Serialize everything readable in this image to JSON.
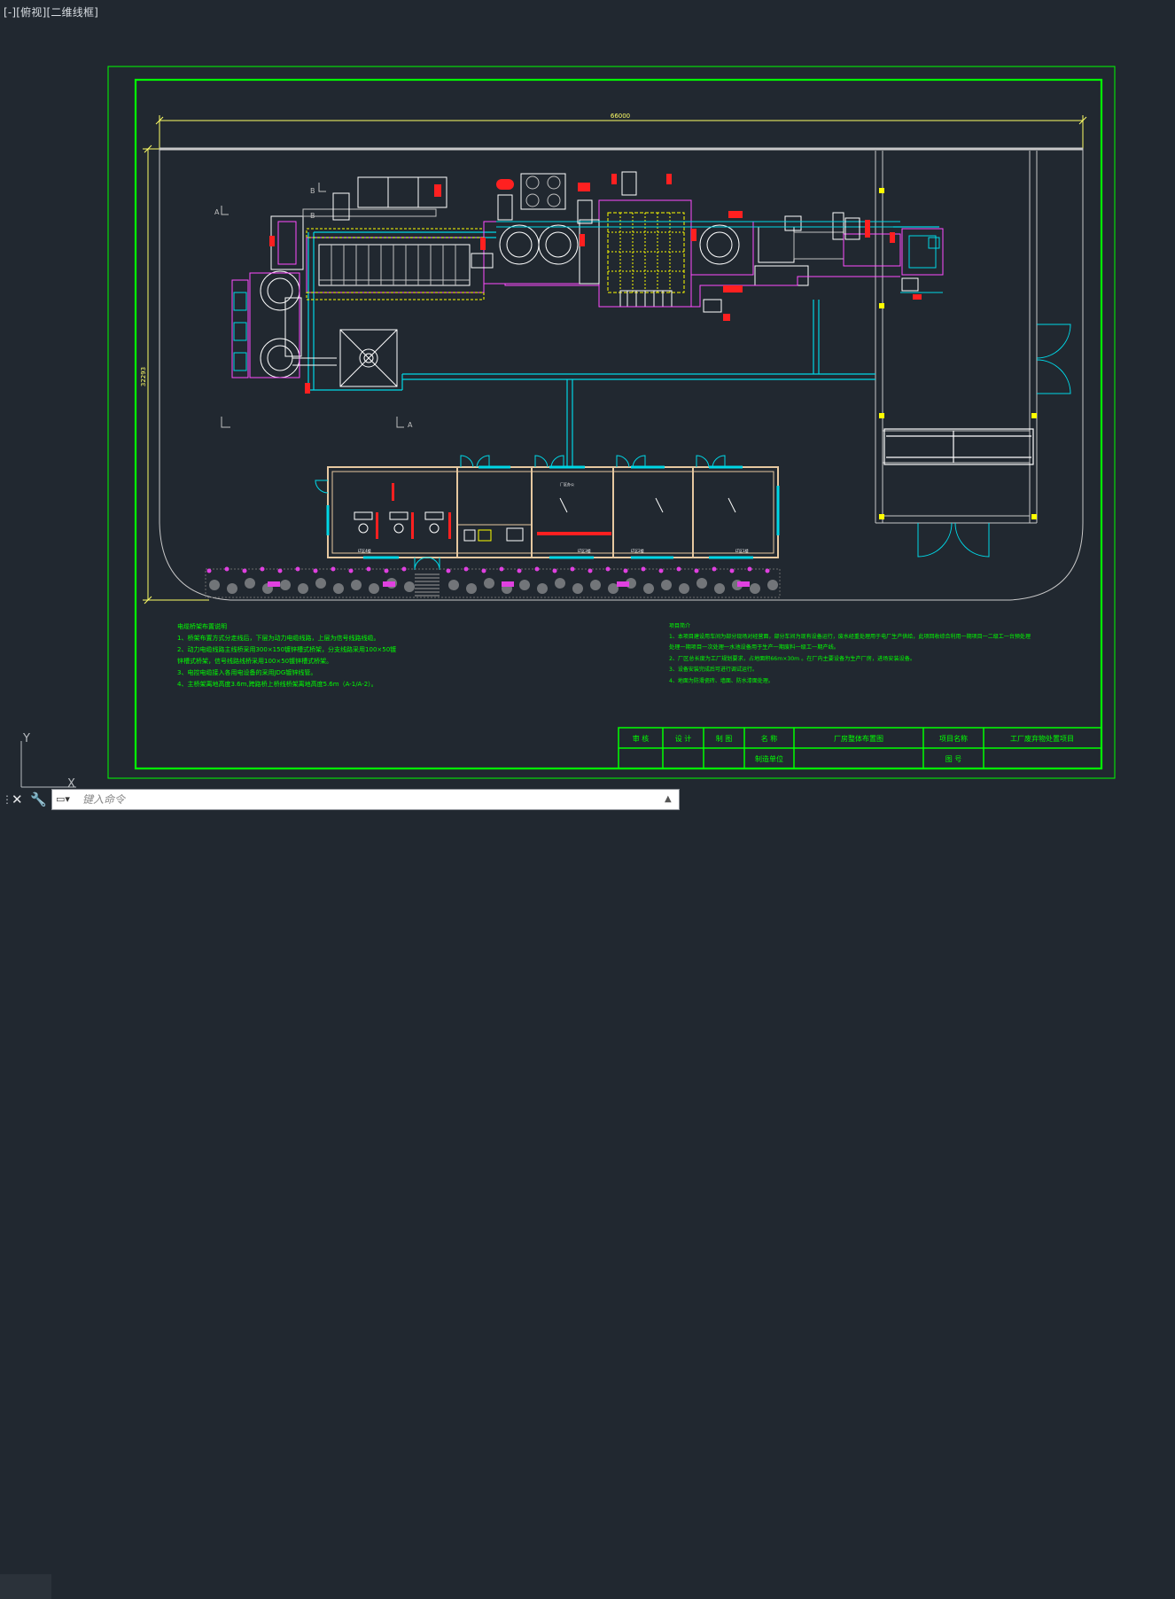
{
  "viewport": {
    "label": "[-][俯视][二维线框]"
  },
  "dimensions": {
    "horizontal": "66000",
    "vertical": "32293"
  },
  "section_marks": [
    "A",
    "A",
    "B",
    "B"
  ],
  "notes_left": {
    "title": "电缆桥架布置说明",
    "lines": [
      "1、桥架布置方式分走线后，下层为动力电缆线路，上层为信号线路线缆。",
      "2、动力电缆线路主线桥采用300×150镀锌槽式桥架，分支线路采用100×50镀",
      "    锌槽式桥架，信号线路线桥采用100×50镀锌槽式桥架。",
      "3、电控电缆接入各用电设备的采用JDG镀锌线管。",
      "4、主桥架离地高度3.6m,跨路桥上桥线桥架离地高度5.6m（A-1/A-2）。"
    ]
  },
  "notes_right": {
    "title": "项目简介",
    "lines": [
      "1、本项目建设用车间为部分现场对经营面，部分车间为现有设备运行，废水经重处理用于电厂生产供给，此项回收综合利用一期项目一二级工一台预处理",
      "处理一期项目一次处理一水池设备用于生产一期废料一级工一期产线。",
      "2、厂区总长度为工厂规划要求，占地面积66m×30m         。在厂内主要设备为生产厂房，进场安装设备。",
      "3、设备安装完成后可进行调试运行。",
      "4、地面为防滑瓷砖、墙面、防水漆面处理。"
    ]
  },
  "title_block": {
    "row1": [
      "审 核",
      "设 计",
      "制 图",
      "名 称",
      "厂房整体布置图",
      "项目名称",
      "工厂废弃物处置项目"
    ],
    "row2": [
      "制造单位",
      "图 号"
    ]
  },
  "room_labels": [
    "厂区办公",
    "LT区4楼",
    "LT区3楼",
    "LT区2楼",
    "LT区1楼"
  ],
  "command_line": {
    "placeholder": "键入命令"
  },
  "ucs": {
    "y_label": "Y",
    "x_label": "X"
  },
  "colors": {
    "background": "#212830",
    "frame_green": "#00ff00",
    "cyan": "#00d7e6",
    "magenta": "#ff4cff",
    "yellow": "#ffff00",
    "red": "#ff2020",
    "white": "#e9e9e9",
    "gray_line": "#bfbfbf"
  }
}
